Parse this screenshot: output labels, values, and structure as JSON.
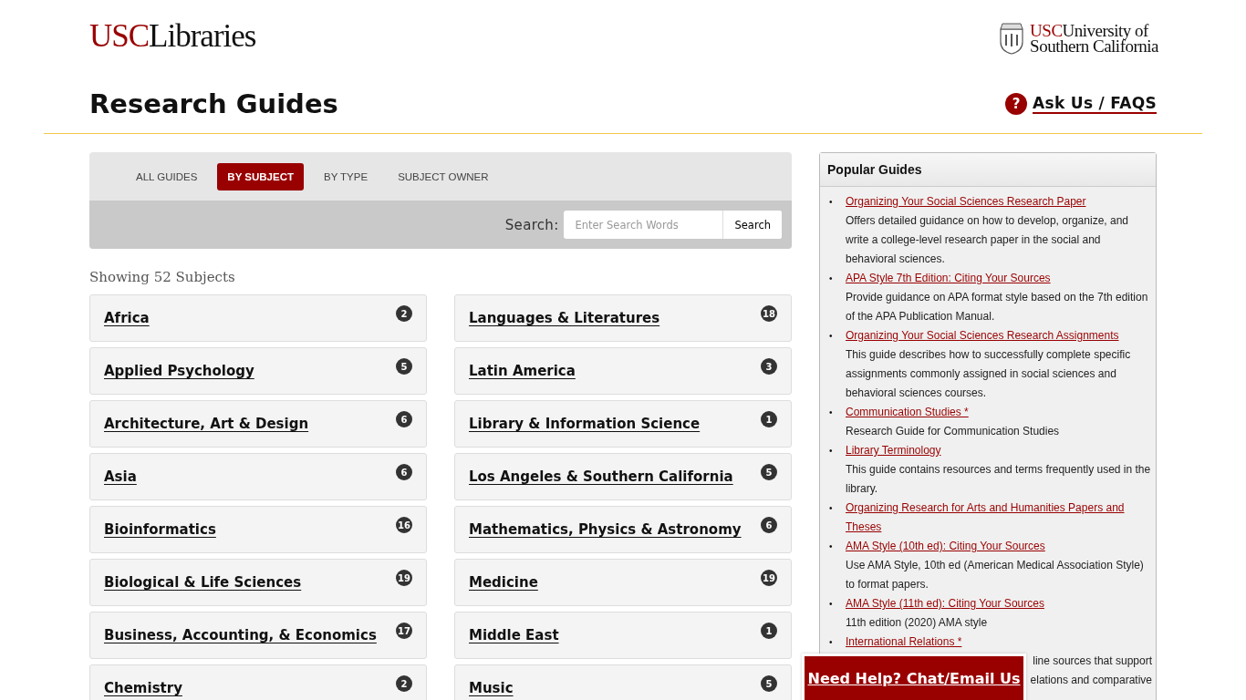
{
  "header": {
    "logo": {
      "brand": "USC",
      "name": "Libraries"
    },
    "university_logo": {
      "brand": "USC",
      "line_1": "University of",
      "line_2": "Southern California"
    },
    "title": "Research Guides",
    "help_link": {
      "icon": "?",
      "label": "Ask Us / FAQS"
    }
  },
  "tabs": [
    {
      "label": "ALL GUIDES",
      "selected": false
    },
    {
      "label": "BY SUBJECT",
      "selected": true
    },
    {
      "label": "BY TYPE",
      "selected": false
    },
    {
      "label": "SUBJECT OWNER",
      "selected": false
    }
  ],
  "search": {
    "label": "Search:",
    "placeholder": "Enter Search Words",
    "button": "Search"
  },
  "summary": "Showing 52 Subjects",
  "subjects": [
    {
      "name": "Africa",
      "count": "2"
    },
    {
      "name": "Languages & Literatures",
      "count": "18"
    },
    {
      "name": "Applied Psychology",
      "count": "5"
    },
    {
      "name": "Latin America",
      "count": "3"
    },
    {
      "name": "Architecture, Art & Design",
      "count": "6"
    },
    {
      "name": "Library & Information Science",
      "count": "1"
    },
    {
      "name": "Asia",
      "count": "6"
    },
    {
      "name": "Los Angeles & Southern California",
      "count": "5"
    },
    {
      "name": "Bioinformatics",
      "count": "16"
    },
    {
      "name": "Mathematics, Physics & Astronomy",
      "count": "6"
    },
    {
      "name": "Biological & Life Sciences",
      "count": "19"
    },
    {
      "name": "Medicine",
      "count": "19"
    },
    {
      "name": "Business, Accounting, & Economics",
      "count": "17"
    },
    {
      "name": "Middle East",
      "count": "1"
    },
    {
      "name": "Chemistry",
      "count": "2"
    },
    {
      "name": "Music",
      "count": "5"
    }
  ],
  "popular_guides": {
    "title": "Popular Guides",
    "bullet": "•",
    "items": [
      {
        "title": "Organizing Your Social Sciences Research Paper",
        "description": "Offers detailed guidance on how to develop, organize, and write a college-level research paper in the social and behavioral sciences."
      },
      {
        "title": "APA Style 7th Edition: Citing Your Sources",
        "description": "Provide guidance on APA format style based on the 7th edition of the APA Publication Manual."
      },
      {
        "title": "Organizing Your Social Sciences Research Assignments",
        "description": "This guide describes how to successfully complete specific assignments commonly assigned in social sciences and behavioral sciences courses."
      },
      {
        "title": "Communication Studies *",
        "description": "Research Guide for Communication Studies"
      },
      {
        "title": "Library Terminology",
        "description": "This guide contains resources and terms frequently used in the library."
      },
      {
        "title": "Organizing Research for Arts and Humanities Papers and Theses"
      },
      {
        "title": "AMA Style (10th ed): Citing Your Sources",
        "description": "Use AMA Style, 10th ed (American Medical Association Style) to format papers."
      },
      {
        "title": "AMA Style (11th ed): Citing Your Sources",
        "description": "11th edition (2020) AMA style"
      },
      {
        "title": "International Relations *",
        "covered_lines": [
          "line sources that support",
          "elations and comparative"
        ]
      }
    ]
  },
  "chat_button": "Need Help? Chat/Email Us"
}
